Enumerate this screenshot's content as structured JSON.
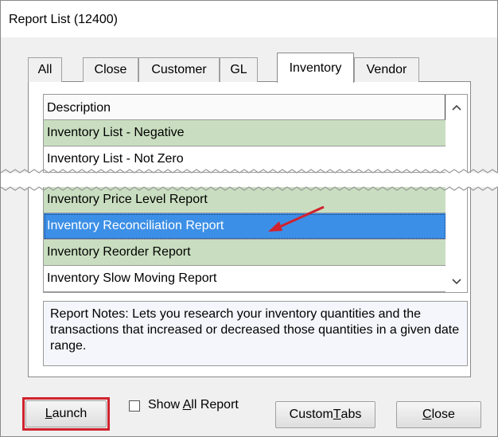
{
  "window": {
    "title": "Report List (12400)"
  },
  "tabs": [
    {
      "label": "All"
    },
    {
      "label": "Close"
    },
    {
      "label": "Customer"
    },
    {
      "label": "GL"
    },
    {
      "label": "Inventory",
      "active": true
    },
    {
      "label": "Vendor"
    }
  ],
  "list": {
    "header": "Description",
    "rows": [
      {
        "label": "Inventory List - Negative",
        "style": "green"
      },
      {
        "label": "Inventory List - Not Zero",
        "style": "white"
      },
      {
        "label": "Inventory Price Level Report",
        "style": "green"
      },
      {
        "label": "Inventory Reconciliation Report",
        "style": "selected"
      },
      {
        "label": "Inventory Reorder Report",
        "style": "green"
      },
      {
        "label": "Inventory Slow Moving Report",
        "style": "white"
      }
    ]
  },
  "notes": {
    "text": "Report Notes:  Lets you research your inventory quantities and the transactions that increased or decreased those quantities in a given date range."
  },
  "footer": {
    "launch_pre": "",
    "launch_mnemonic": "L",
    "launch_post": "aunch",
    "show_all_pre": "Show ",
    "show_all_mnemonic": "A",
    "show_all_post": "ll Report",
    "show_all_checked": false,
    "custom_tabs_pre": "Custom ",
    "custom_tabs_mnemonic": "T",
    "custom_tabs_post": "abs",
    "close_pre": "",
    "close_mnemonic": "C",
    "close_post": "lose"
  },
  "colors": {
    "selected_row": "#3c8fe6",
    "green_row": "#c9dec0",
    "highlight_box": "#d0222e",
    "annotation_arrow": "#d0222e"
  },
  "icons": {
    "scroll_up": "chevron-up-icon",
    "scroll_down": "chevron-down-icon"
  }
}
